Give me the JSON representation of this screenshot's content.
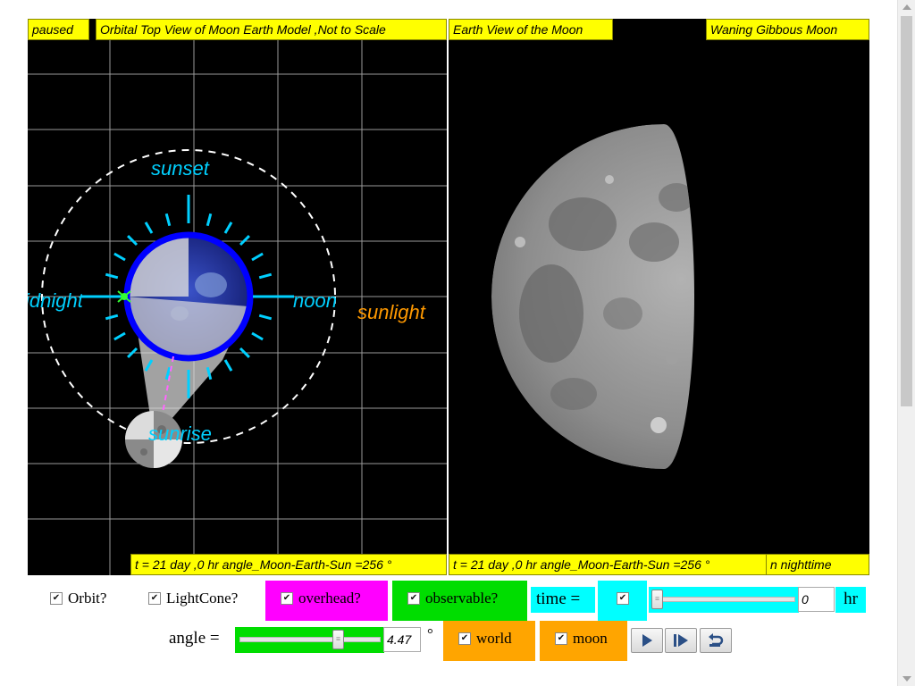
{
  "left_panel": {
    "status": "paused",
    "title": "Orbital Top View of Moon Earth Model ,Not to Scale",
    "time_readout": "t = 21 day ,0 hr angle_Moon-Earth-Sun =256 °",
    "labels": {
      "sunset": "sunset",
      "midnight": "idnight",
      "noon": "noon",
      "sunrise": "sunrise",
      "sunlight": "sunlight"
    }
  },
  "right_panel": {
    "title": "Earth View of the Moon",
    "phase": "Waning Gibbous Moon",
    "time_readout": "t = 21 day ,0 hr angle_Moon-Earth-Sun =256 °",
    "night_readout": "n nighttime"
  },
  "controls": {
    "orbit": {
      "label": "Orbit?",
      "checked": true
    },
    "lightcone": {
      "label": "LightCone?",
      "checked": true
    },
    "overhead": {
      "label": "overhead?",
      "checked": true
    },
    "observable": {
      "label": "observable?",
      "checked": true
    },
    "time_label": "time =",
    "time_checkbox": {
      "checked": true
    },
    "time_value": "0",
    "time_unit": "hr",
    "angle_label": "angle =",
    "angle_value": "4.47",
    "angle_unit": "°",
    "world": {
      "label": "world",
      "checked": true
    },
    "moon": {
      "label": "moon",
      "checked": true
    },
    "check_glyph": "✔"
  },
  "colors": {
    "overhead_bg": "#ff00ff",
    "observable_bg": "#00dd00",
    "time_bg": "#00ffff",
    "toggle_bg": "#ffa500",
    "label_bg": "#ffff00"
  },
  "icons": {
    "play": "play-icon",
    "step": "step-forward-icon",
    "reset": "reset-icon"
  }
}
